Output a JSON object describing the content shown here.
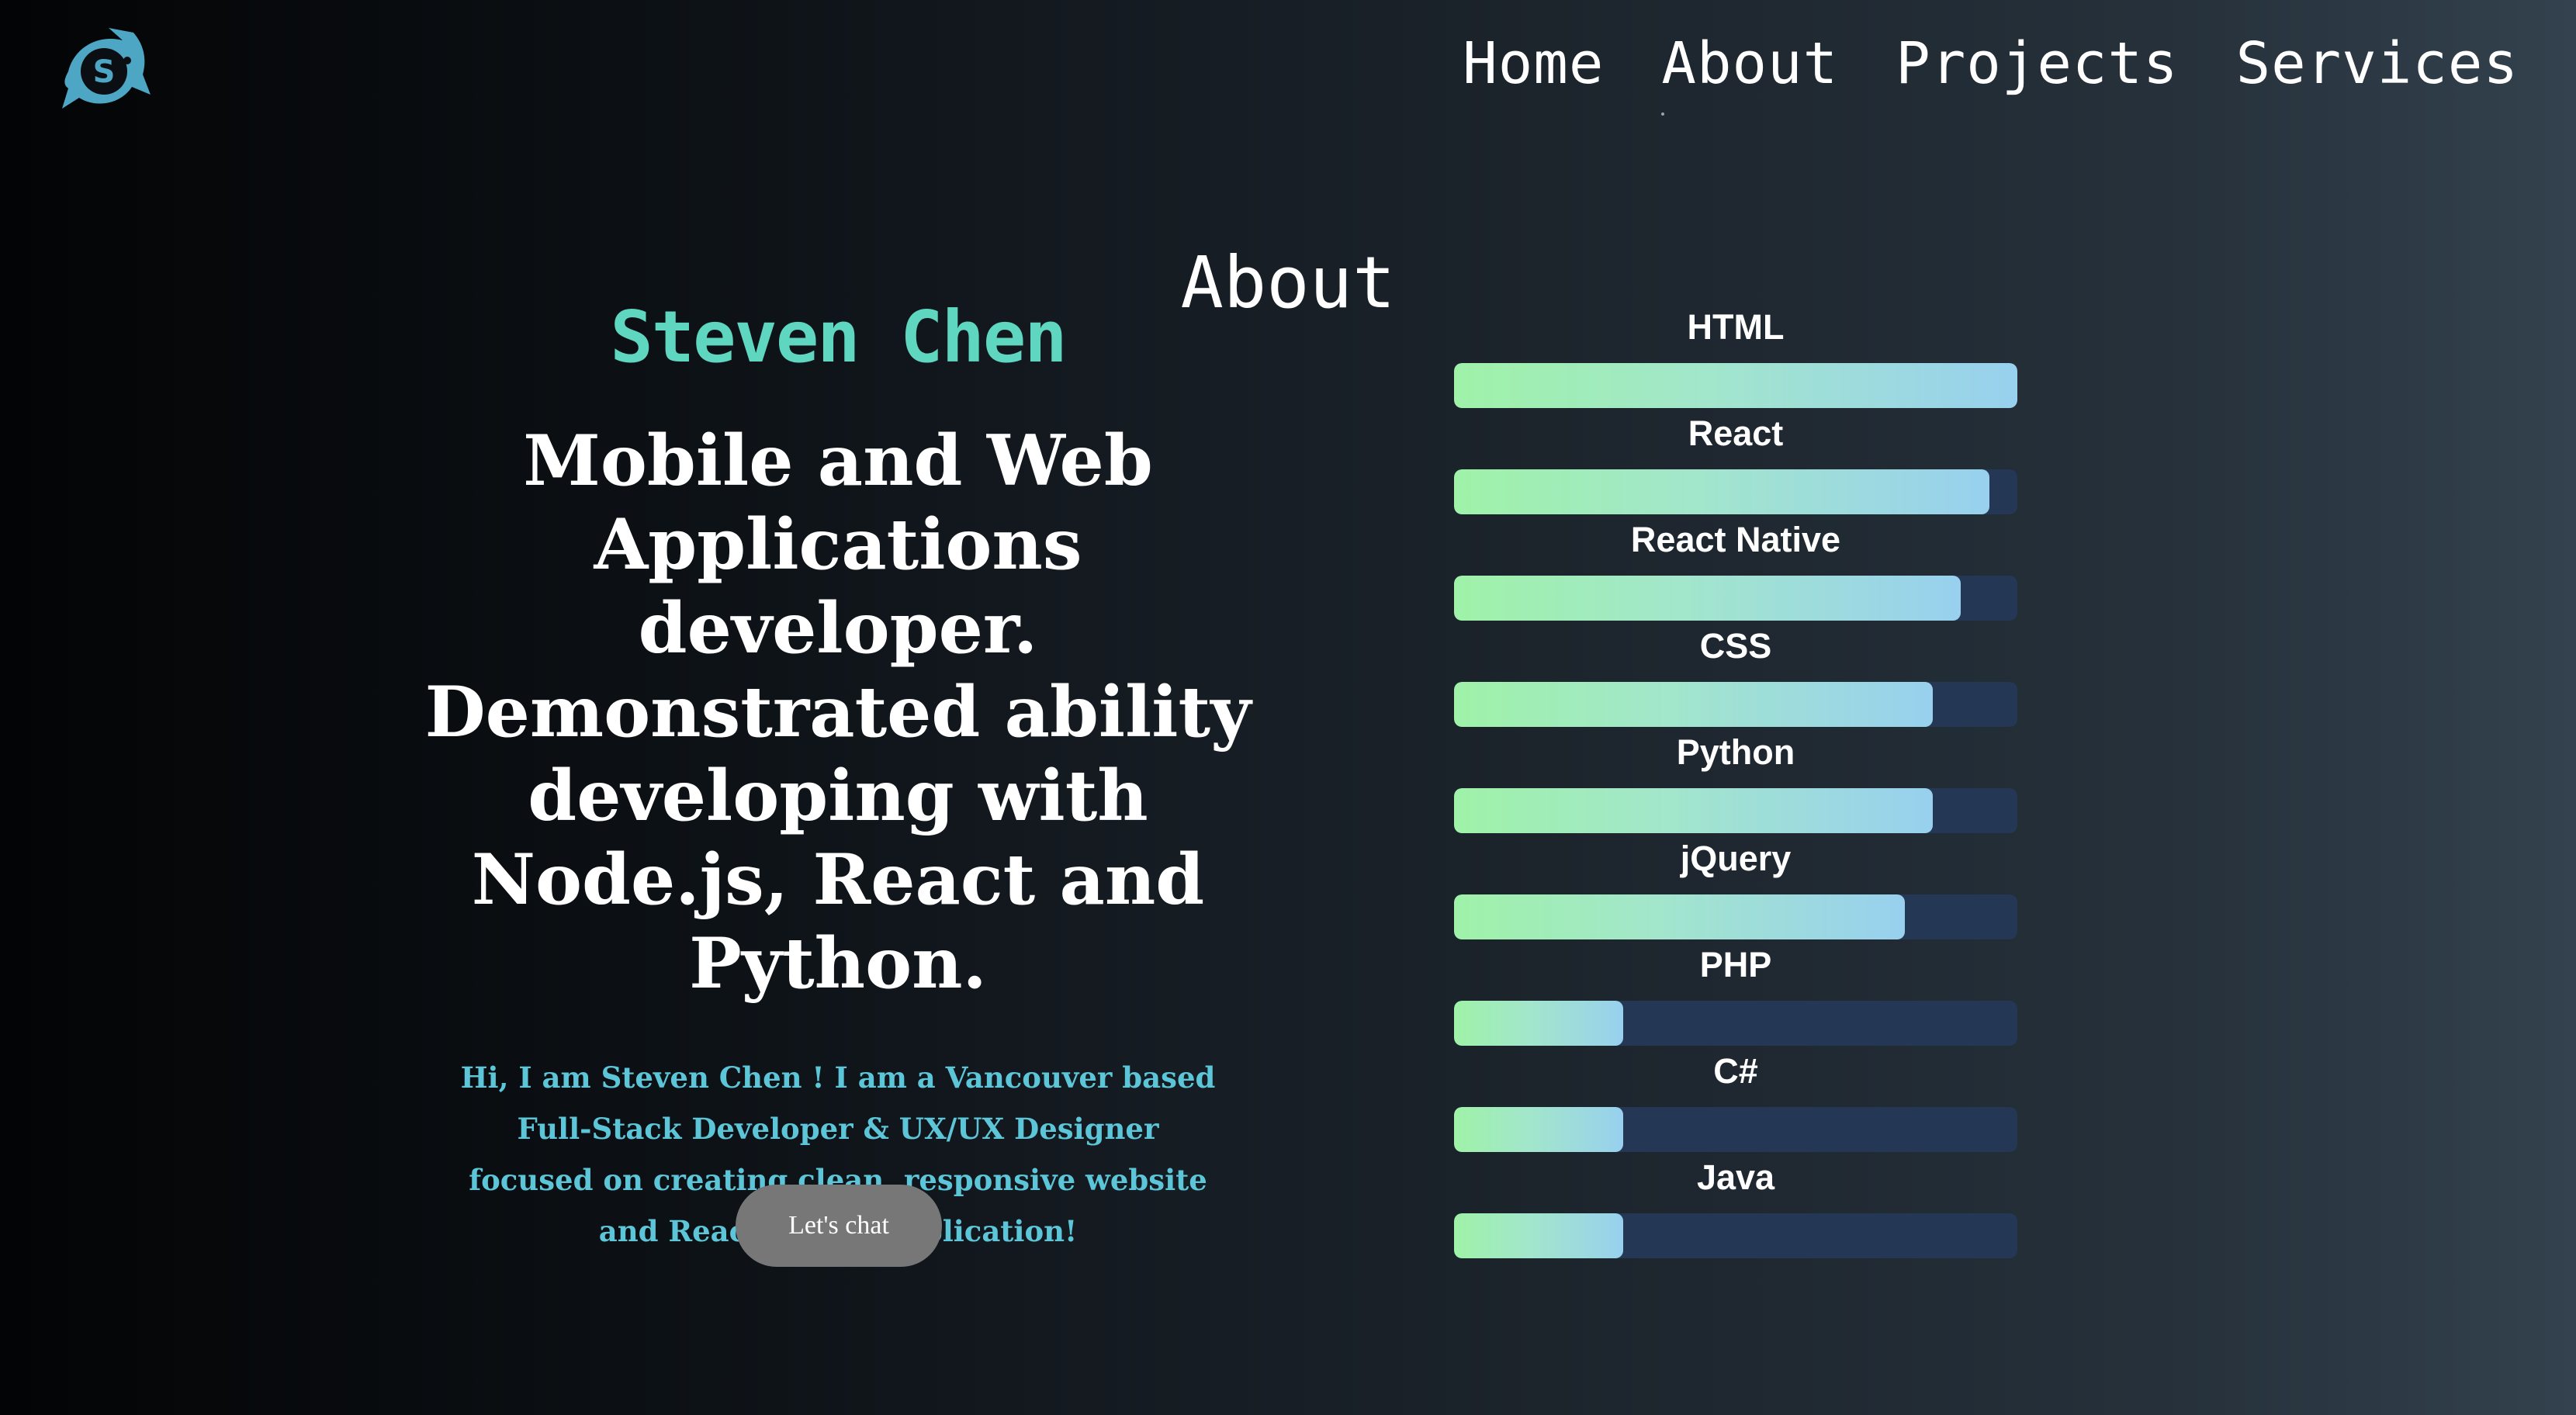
{
  "logo": {
    "icon": "fish-logo-icon",
    "letter": "S",
    "accent": "#4da6c4",
    "dark": "#0b0f13"
  },
  "nav": {
    "items": [
      {
        "label": "Home"
      },
      {
        "label": "About"
      },
      {
        "label": "Projects"
      },
      {
        "label": "Services"
      }
    ],
    "active": "About"
  },
  "about": {
    "title": "About",
    "name": "Steven Chen",
    "headline": "Mobile and Web Applications developer. Demonstrated ability developing with Node.js, React and Python.",
    "intro": "Hi, I am Steven Chen ! I am a Vancouver based Full-Stack Developer & UX/UX Designer focused on creating clean, responsive website and React Native application!",
    "cta_label": "Let's chat"
  },
  "skills": [
    {
      "name": "HTML",
      "level": 1.0
    },
    {
      "name": "React",
      "level": 0.95
    },
    {
      "name": "React Native",
      "level": 0.9
    },
    {
      "name": "CSS",
      "level": 0.85
    },
    {
      "name": "Python",
      "level": 0.85
    },
    {
      "name": "jQuery",
      "level": 0.8
    },
    {
      "name": "PHP",
      "level": 0.3
    },
    {
      "name": "C#",
      "level": 0.3
    },
    {
      "name": "Java",
      "level": 0.3
    }
  ],
  "colors": {
    "name_accent": "#5fd6c0",
    "intro_text": "#5cc6d8",
    "bar_track": "#243755",
    "bar_gradient_start": "#9ff2a8",
    "bar_gradient_end": "#98d0ee",
    "cta_background": "#777777"
  }
}
